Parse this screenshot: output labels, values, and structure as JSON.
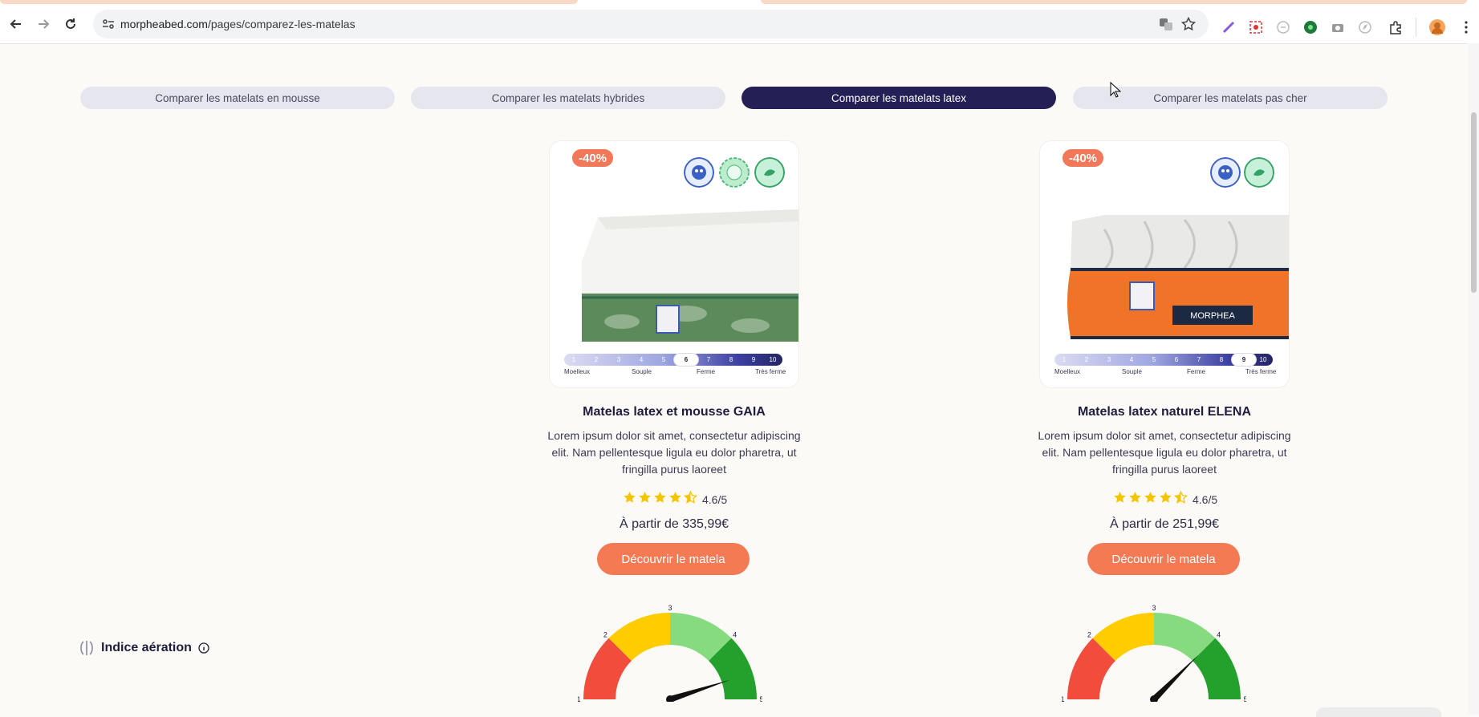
{
  "browser": {
    "url_host": "morpheabed.com",
    "url_path": "/pages/comparez-les-matelas"
  },
  "page": {
    "tabs": [
      {
        "label": "Comparer les matelats en mousse",
        "active": false
      },
      {
        "label": "Comparer les matelats hybrides",
        "active": false
      },
      {
        "label": "Comparer les matelats latex",
        "active": true
      },
      {
        "label": "Comparer les matelats pas cher",
        "active": false
      }
    ],
    "aeration_label": "Indice aération",
    "products": [
      {
        "discount": "-40%",
        "name": "Matelas latex et mousse GAIA",
        "description": "Lorem ipsum dolor sit amet, consectetur adipiscing elit. Nam pellentesque ligula eu dolor pharetra, ut fringilla purus laoreet",
        "rating_stars": 4.5,
        "rating": "4.6/5",
        "price": "À partir de 335,99€",
        "cta": "Découvrir le matela",
        "firmness": 6,
        "aeration": 4.6,
        "brand_label": ""
      },
      {
        "discount": "-40%",
        "name": "Matelas latex naturel ELENA",
        "description": "Lorem ipsum dolor sit amet, consectetur adipiscing elit. Nam pellentesque ligula eu dolor pharetra, ut fringilla purus laoreet",
        "rating_stars": 4.5,
        "rating": "4.6/5",
        "price": "À partir de 251,99€",
        "cta": "Découvrir le matela",
        "firmness": 9,
        "aeration": 4.0,
        "brand_label": "MORPHEA"
      }
    ],
    "firmness_scale": {
      "numbers": [
        "1",
        "2",
        "3",
        "4",
        "5",
        "6",
        "7",
        "8",
        "9",
        "10"
      ],
      "labels": [
        "Moelleux",
        "Souple",
        "Ferme",
        "Très ferme"
      ]
    },
    "gauge_ticks": [
      "1",
      "2",
      "3",
      "4",
      "5"
    ]
  },
  "colors": {
    "accent": "#f47a54",
    "navy": "#241f55",
    "gauge_red": "#f24c3d",
    "gauge_yellow": "#ffcc00",
    "gauge_lightgreen": "#86db7e",
    "gauge_green": "#24a02c",
    "star": "#f5c400"
  }
}
